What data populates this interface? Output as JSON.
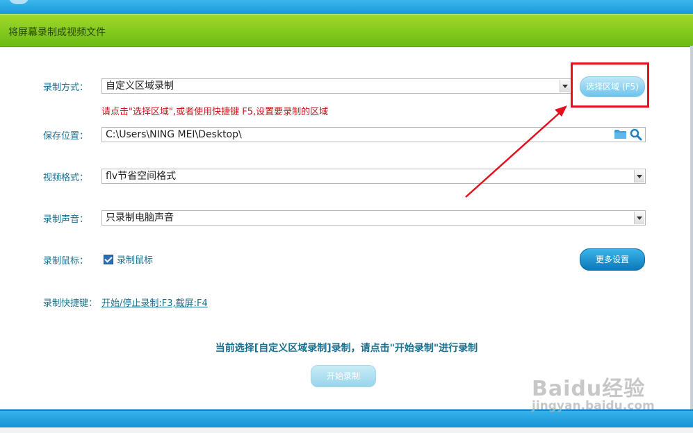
{
  "header": {
    "title": "将屏幕录制成视频文件"
  },
  "form": {
    "record_mode": {
      "label": "录制方式：",
      "value": "自定义区域录制"
    },
    "select_area_button": "选择区域 (F5)",
    "hint": "请点击\"选择区域\",或者使用快捷键 F5,设置要录制的区域",
    "save_location": {
      "label": "保存位置：",
      "value": "C:\\Users\\NING MEI\\Desktop\\"
    },
    "video_format": {
      "label": "视频格式：",
      "value": "flv节省空间格式"
    },
    "audio": {
      "label": "录制声音：",
      "value": "只录制电脑声音"
    },
    "mouse": {
      "label": "录制鼠标：",
      "checkbox_label": "录制鼠标",
      "checked": true
    },
    "more_settings_button": "更多设置",
    "shortcut": {
      "label": "录制快捷键：",
      "value": "开始/停止录制:F3,截屏:F4"
    }
  },
  "status_text": "当前选择[自定义区域录制]录制，请点击\"开始录制\"进行录制",
  "start_button": "开始录制",
  "watermark": {
    "main": "Baidu经验",
    "sub": "jingyan.baidu.com"
  },
  "colors": {
    "accent_blue": "#1a9ad8",
    "header_green": "#7cc51c",
    "label_text": "#1a6f8f",
    "hint_red": "#c0161b",
    "annotation_red": "#e3101e"
  },
  "icons": [
    "folder-icon",
    "search-icon",
    "dropdown-arrow-icon",
    "checkbox-checked-icon"
  ]
}
